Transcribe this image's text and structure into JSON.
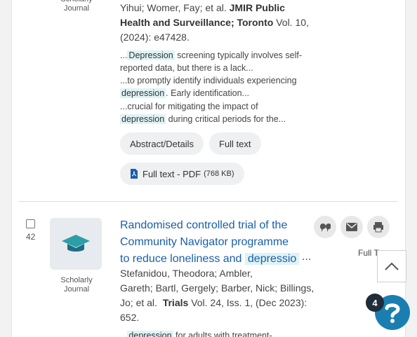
{
  "record1": {
    "type_label": "Scholarly Journal",
    "citation_lines": [
      "Yihui; Womer, Fay; et al.",
      "JMIR Public",
      "Health and Surveillance; Toronto",
      "Vol. 10,",
      "(2024): e47428."
    ],
    "snippet_1_prefix": "...",
    "snippet_1_hl": "Depression",
    "snippet_1_suffix": " screening typically involves self-",
    "snippet_1_line2": "reported data, but there is a lack...",
    "snippet_2": "...to promptly identify individuals experiencing",
    "snippet_2_hl": "depression",
    "snippet_2_suffix": ". Early identification...",
    "snippet_3": "...crucial for mitigating the impact of",
    "snippet_3_hl": "depression",
    "snippet_3_suffix": " during critical periods for the...",
    "btn_abstract": "Abstract/Details",
    "btn_fulltext": "Full text",
    "btn_pdf": "Full text - PDF",
    "btn_pdf_size": "(768 KB)"
  },
  "record2": {
    "number": "42",
    "type_label": "Scholarly Journal",
    "title_line1": "Randomised controlled trial of the",
    "title_line2": "Community Navigator programme",
    "title_line3_prefix": "to reduce loneliness and",
    "title_line3_hl": "depressio",
    "title_ellipsis": "...",
    "authors_line1": "Stefanidou, Theodora; Ambler,",
    "authors_line2": "Gareth; Bartl, Gergely; Barber, Nick; Billings,",
    "authors_line3_prefix": "Jo; et al.",
    "journal": "Trials",
    "authors_line3_suffix": "Vol. 24, Iss. 1,  (Dec 2023):",
    "authors_line4": "652.",
    "snippet_hl": "depression",
    "snippet_suffix": " for adults with treatment-",
    "full_text_label": "Full T"
  },
  "badge_count": "4"
}
